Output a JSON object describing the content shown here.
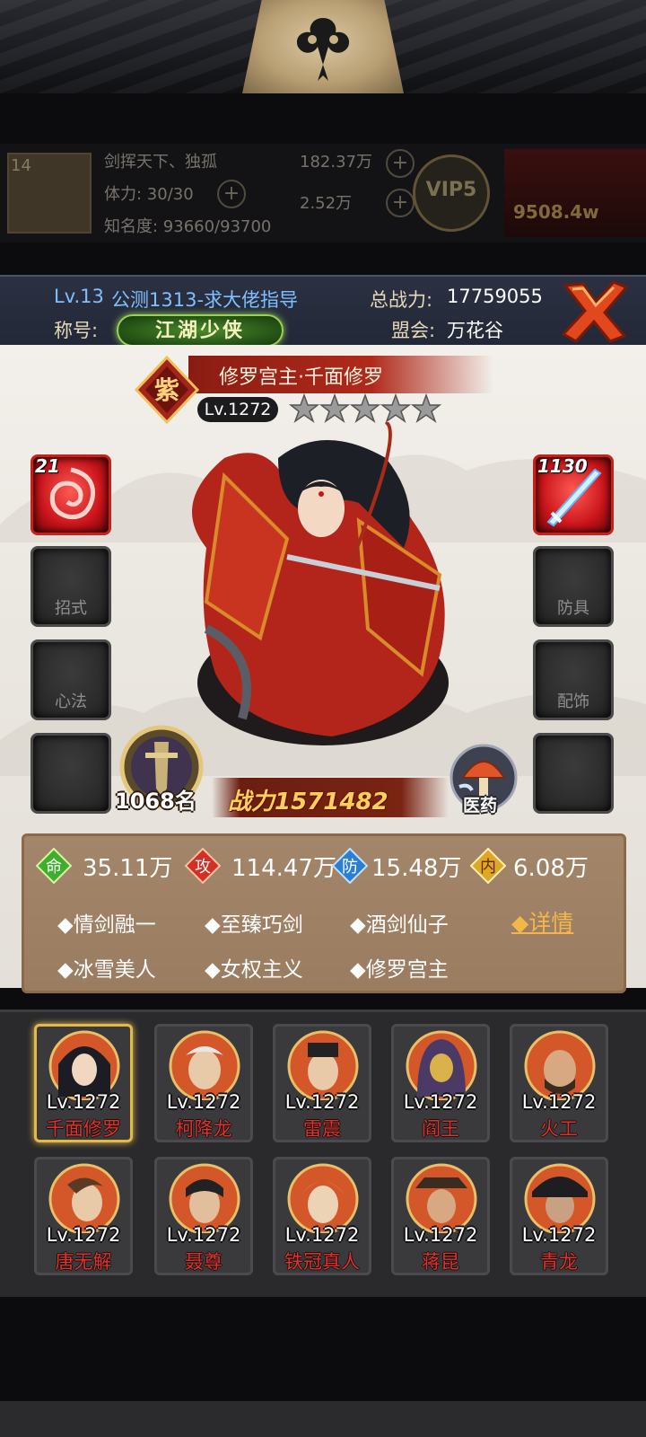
{
  "background_bar": {
    "level": "14",
    "player_name": "剑挥天下、独孤",
    "stamina": "体力: 30/30",
    "fame": "知名度: 93660/93700",
    "silver": "182.37万",
    "gold": "2.52万",
    "vip": "VIP5",
    "power": "9508.4w"
  },
  "player": {
    "level": "Lv.13",
    "server_name": "公测1313-求大佬指导",
    "total_power_label": "总战力:",
    "total_power": "17759055",
    "title_label": "称号:",
    "title_badge": "江湖少侠",
    "guild_label": "盟会:",
    "guild": "万花谷"
  },
  "hero": {
    "rarity": "紫",
    "name": "修罗宫主·千面修罗",
    "level": "Lv.1272",
    "stars": 5,
    "rank": "1068名",
    "power": "战力1571482",
    "medicine_label": "医药"
  },
  "slots": {
    "left": [
      {
        "label": "",
        "count": "21",
        "filled": true
      },
      {
        "label": "招式",
        "count": "",
        "filled": false
      },
      {
        "label": "心法",
        "count": "",
        "filled": false
      },
      {
        "label": "",
        "count": "",
        "filled": false
      }
    ],
    "right": [
      {
        "label": "",
        "count": "1130",
        "filled": true
      },
      {
        "label": "防具",
        "count": "",
        "filled": false
      },
      {
        "label": "配饰",
        "count": "",
        "filled": false
      },
      {
        "label": "",
        "count": "",
        "filled": false
      }
    ]
  },
  "stats": {
    "hp": {
      "icon": "命",
      "value": "35.11万",
      "color": "#3fae2c"
    },
    "atk": {
      "icon": "攻",
      "value": "114.47万",
      "color": "#d42f24"
    },
    "def": {
      "icon": "防",
      "value": "15.48万",
      "color": "#2b7fd3"
    },
    "inner": {
      "icon": "内",
      "value": "6.08万",
      "color": "#e0a626"
    }
  },
  "tags": [
    "◆情剑融一",
    "◆至臻巧剑",
    "◆酒剑仙子",
    "◆冰雪美人",
    "◆女权主义",
    "◆修罗宫主"
  ],
  "detail_label": "◆详情",
  "roster": [
    {
      "level": "Lv.1272",
      "name": "千面修罗"
    },
    {
      "level": "Lv.1272",
      "name": "柯降龙"
    },
    {
      "level": "Lv.1272",
      "name": "雷震"
    },
    {
      "level": "Lv.1272",
      "name": "阎王"
    },
    {
      "level": "Lv.1272",
      "name": "火工"
    },
    {
      "level": "Lv.1272",
      "name": "唐无解"
    },
    {
      "level": "Lv.1272",
      "name": "聂尊"
    },
    {
      "level": "Lv.1272",
      "name": "铁冠真人"
    },
    {
      "level": "Lv.1272",
      "name": "蒋昆"
    },
    {
      "level": "Lv.1272",
      "name": "青龙"
    }
  ]
}
